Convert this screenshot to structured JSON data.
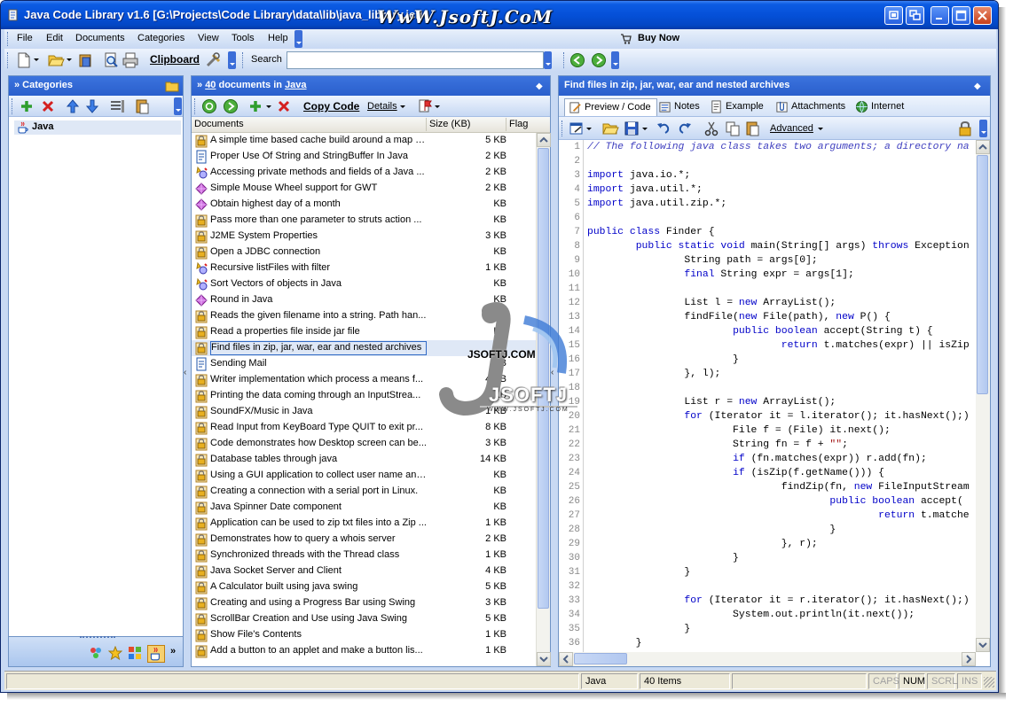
{
  "window": {
    "title": "Java Code Library v1.6 [G:\\Projects\\Code Library\\data\\lib\\java_library.jcl]",
    "watermark_top": "WwW.JsoftJ.CoM"
  },
  "menu": {
    "items": [
      "File",
      "Edit",
      "Documents",
      "Categories",
      "View",
      "Tools",
      "Help"
    ],
    "buy_now": "Buy Now"
  },
  "toolbar": {
    "clipboard_label": "Clipboard",
    "search_label": "Search",
    "search_value": ""
  },
  "categories_panel": {
    "title": "» Categories",
    "items": [
      "Java"
    ]
  },
  "documents_panel": {
    "title_prefix": "» ",
    "count": "40",
    "title_mid": " documents in ",
    "category": "Java",
    "copy_code": "Copy Code",
    "details": "Details",
    "columns": [
      "Documents",
      "Size (KB)",
      "Flag"
    ],
    "rows": [
      {
        "name": "A simple time based cache build around a map st...",
        "size": "5 KB",
        "icon": "lock-doc-icon"
      },
      {
        "name": "Proper Use Of String and StringBuffer In Java",
        "size": "2 KB",
        "icon": "doc-icon"
      },
      {
        "name": "Accessing private methods and fields of a Java ...",
        "size": "2 KB",
        "icon": "gear-doc-icon"
      },
      {
        "name": "Simple Mouse Wheel support for GWT",
        "size": "2 KB",
        "icon": "gem-icon"
      },
      {
        "name": "Obtain highest day of a month",
        "size": "KB",
        "icon": "gem-icon"
      },
      {
        "name": "Pass more than one parameter to struts action ...",
        "size": "KB",
        "icon": "lock-doc-icon"
      },
      {
        "name": "J2ME System Properties",
        "size": "3 KB",
        "icon": "lock-doc-icon"
      },
      {
        "name": "Open a JDBC connection",
        "size": "KB",
        "icon": "lock-doc-icon"
      },
      {
        "name": "Recursive listFiles with filter",
        "size": "1 KB",
        "icon": "gear-doc-icon"
      },
      {
        "name": "Sort Vectors of objects in Java",
        "size": "KB",
        "icon": "gear-doc-icon"
      },
      {
        "name": "Round in Java",
        "size": "KB",
        "icon": "gem-icon"
      },
      {
        "name": "Reads the given filename into a string. Path han...",
        "size": "KB",
        "icon": "lock-doc-icon"
      },
      {
        "name": "Read a properties file inside jar file",
        "size": "KB",
        "icon": "lock-doc-icon"
      },
      {
        "name": "Find files in zip, jar, war, ear and nested archives",
        "size": "KB",
        "icon": "lock-doc-icon",
        "selected": true
      },
      {
        "name": "Sending Mail",
        "size": "KB",
        "icon": "doc-icon"
      },
      {
        "name": "Writer implementation which process a means f...",
        "size": "4 KB",
        "icon": "lock-doc-icon"
      },
      {
        "name": "Printing the data coming through an InputStrea...",
        "size": "1 KB",
        "icon": "lock-doc-icon"
      },
      {
        "name": "SoundFX/Music in Java",
        "size": "1 KB",
        "icon": "lock-doc-icon"
      },
      {
        "name": "Read Input from KeyBoard Type QUIT to exit pr...",
        "size": "8 KB",
        "icon": "lock-doc-icon"
      },
      {
        "name": "Code demonstrates how Desktop screen can be...",
        "size": "3 KB",
        "icon": "lock-doc-icon"
      },
      {
        "name": "Database tables through java",
        "size": "14 KB",
        "icon": "lock-doc-icon"
      },
      {
        "name": "Using a GUI application to collect user name and...",
        "size": "KB",
        "icon": "lock-doc-icon"
      },
      {
        "name": "Creating a connection with a serial port in Linux.",
        "size": "KB",
        "icon": "lock-doc-icon"
      },
      {
        "name": "Java Spinner Date component",
        "size": "KB",
        "icon": "lock-doc-icon"
      },
      {
        "name": "Application can be used to zip txt files into a Zip ...",
        "size": "1 KB",
        "icon": "lock-doc-icon"
      },
      {
        "name": "Demonstrates how to query a whois server",
        "size": "2 KB",
        "icon": "lock-doc-icon"
      },
      {
        "name": "Synchronized threads with the Thread class",
        "size": "1 KB",
        "icon": "lock-doc-icon"
      },
      {
        "name": "Java Socket Server and Client",
        "size": "4 KB",
        "icon": "lock-doc-icon"
      },
      {
        "name": "A Calculator built using java swing",
        "size": "5 KB",
        "icon": "lock-doc-icon"
      },
      {
        "name": "Creating and using a Progress Bar using Swing",
        "size": "3 KB",
        "icon": "lock-doc-icon"
      },
      {
        "name": "ScrollBar Creation and Use using Java Swing",
        "size": "5 KB",
        "icon": "lock-doc-icon"
      },
      {
        "name": "Show File's Contents",
        "size": "1 KB",
        "icon": "lock-doc-icon"
      },
      {
        "name": "Add a button to an applet and make a button lis...",
        "size": "1 KB",
        "icon": "lock-doc-icon"
      }
    ]
  },
  "preview_panel": {
    "title": "Find files in zip, jar, war, ear and nested archives",
    "tabs": [
      "Preview / Code",
      "Notes",
      "Example",
      "Attachments",
      "Internet"
    ],
    "advanced": "Advanced",
    "code_lines": [
      {
        "n": "1",
        "parts": [
          [
            "cm",
            "// The following java class takes two arguments; a directory na"
          ]
        ]
      },
      {
        "n": "2",
        "parts": []
      },
      {
        "n": "3",
        "parts": [
          [
            "kw",
            "import"
          ],
          [
            "",
            " java.io.*;"
          ]
        ]
      },
      {
        "n": "4",
        "parts": [
          [
            "kw",
            "import"
          ],
          [
            "",
            " java.util.*;"
          ]
        ]
      },
      {
        "n": "5",
        "parts": [
          [
            "kw",
            "import"
          ],
          [
            "",
            " java.util.zip.*;"
          ]
        ]
      },
      {
        "n": "6",
        "parts": []
      },
      {
        "n": "7",
        "parts": [
          [
            "kw",
            "public class"
          ],
          [
            "",
            " Finder {"
          ]
        ]
      },
      {
        "n": "8",
        "parts": [
          [
            "",
            "        "
          ],
          [
            "kw",
            "public static void"
          ],
          [
            "",
            " main(String[] args) "
          ],
          [
            "kw",
            "throws"
          ],
          [
            "",
            " Exception"
          ]
        ]
      },
      {
        "n": "9",
        "parts": [
          [
            "",
            "                String path = args[0];"
          ]
        ]
      },
      {
        "n": "10",
        "parts": [
          [
            "",
            "                "
          ],
          [
            "kw",
            "final"
          ],
          [
            "",
            " String expr = args[1];"
          ]
        ]
      },
      {
        "n": "11",
        "parts": []
      },
      {
        "n": "12",
        "parts": [
          [
            "",
            "                List l = "
          ],
          [
            "kw",
            "new"
          ],
          [
            "",
            " ArrayList();"
          ]
        ]
      },
      {
        "n": "13",
        "parts": [
          [
            "",
            "                findFile("
          ],
          [
            "kw",
            "new"
          ],
          [
            "",
            " File(path), "
          ],
          [
            "kw",
            "new"
          ],
          [
            "",
            " P() {"
          ]
        ]
      },
      {
        "n": "14",
        "parts": [
          [
            "",
            "                        "
          ],
          [
            "kw",
            "public boolean"
          ],
          [
            "",
            " accept(String t) {"
          ]
        ]
      },
      {
        "n": "15",
        "parts": [
          [
            "",
            "                                "
          ],
          [
            "kw",
            "return"
          ],
          [
            "",
            " t.matches(expr) || isZip"
          ]
        ]
      },
      {
        "n": "16",
        "parts": [
          [
            "",
            "                        }"
          ]
        ]
      },
      {
        "n": "17",
        "parts": [
          [
            "",
            "                }, l);"
          ]
        ]
      },
      {
        "n": "18",
        "parts": []
      },
      {
        "n": "19",
        "parts": [
          [
            "",
            "                List r = "
          ],
          [
            "kw",
            "new"
          ],
          [
            "",
            " ArrayList();"
          ]
        ]
      },
      {
        "n": "20",
        "parts": [
          [
            "",
            "                "
          ],
          [
            "kw",
            "for"
          ],
          [
            "",
            " (Iterator it = l.iterator(); it.hasNext();)"
          ]
        ]
      },
      {
        "n": "21",
        "parts": [
          [
            "",
            "                        File f = (File) it.next();"
          ]
        ]
      },
      {
        "n": "22",
        "parts": [
          [
            "",
            "                        String fn = f + "
          ],
          [
            "st",
            "\"\""
          ],
          [
            "",
            ";"
          ]
        ]
      },
      {
        "n": "23",
        "parts": [
          [
            "",
            "                        "
          ],
          [
            "kw",
            "if"
          ],
          [
            "",
            " (fn.matches(expr)) r.add(fn);"
          ]
        ]
      },
      {
        "n": "24",
        "parts": [
          [
            "",
            "                        "
          ],
          [
            "kw",
            "if"
          ],
          [
            "",
            " (isZip(f.getName())) {"
          ]
        ]
      },
      {
        "n": "25",
        "parts": [
          [
            "",
            "                                findZip(fn, "
          ],
          [
            "kw",
            "new"
          ],
          [
            "",
            " FileInputStream"
          ]
        ]
      },
      {
        "n": "26",
        "parts": [
          [
            "",
            "                                        "
          ],
          [
            "kw",
            "public boolean"
          ],
          [
            "",
            " accept("
          ]
        ]
      },
      {
        "n": "27",
        "parts": [
          [
            "",
            "                                                "
          ],
          [
            "kw",
            "return"
          ],
          [
            "",
            " t.matche"
          ]
        ]
      },
      {
        "n": "28",
        "parts": [
          [
            "",
            "                                        }"
          ]
        ]
      },
      {
        "n": "29",
        "parts": [
          [
            "",
            "                                }, r);"
          ]
        ]
      },
      {
        "n": "30",
        "parts": [
          [
            "",
            "                        }"
          ]
        ]
      },
      {
        "n": "31",
        "parts": [
          [
            "",
            "                }"
          ]
        ]
      },
      {
        "n": "32",
        "parts": []
      },
      {
        "n": "33",
        "parts": [
          [
            "",
            "                "
          ],
          [
            "kw",
            "for"
          ],
          [
            "",
            " (Iterator it = r.iterator(); it.hasNext();)"
          ]
        ]
      },
      {
        "n": "34",
        "parts": [
          [
            "",
            "                        System.out.println(it.next());"
          ]
        ]
      },
      {
        "n": "35",
        "parts": [
          [
            "",
            "                }"
          ]
        ]
      },
      {
        "n": "36",
        "parts": [
          [
            "",
            "        }"
          ]
        ]
      }
    ]
  },
  "status": {
    "cells": [
      "",
      "Java",
      "40 Items",
      ""
    ],
    "indicators": [
      "CAPS",
      "NUM",
      "SCRL",
      "INS"
    ],
    "active": [
      "NUM"
    ]
  },
  "watermark": {
    "text1": "JSOFTJ.COM",
    "text2": "JSOFTJ",
    "text3": "W W W . J S O F T J . C O M"
  },
  "colors": {
    "titlebar": "#0550d8",
    "panel_header": "#2a5fcc",
    "keyword": "#0000c8",
    "comment": "#3f3fbf",
    "selection": "#dfe8f6"
  }
}
